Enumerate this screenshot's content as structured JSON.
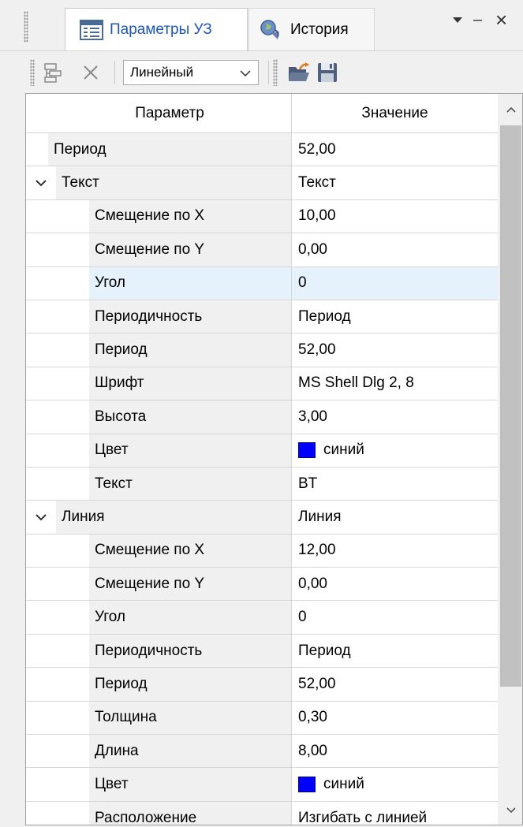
{
  "tabs": [
    {
      "label": "Параметры УЗ",
      "icon": "properties-table-icon",
      "active": true
    },
    {
      "label": "История",
      "icon": "history-icon",
      "active": false
    }
  ],
  "tab_controls": {
    "menu_icon": "dropdown-triangle-icon",
    "minimize": "–",
    "close": "×"
  },
  "toolbar": {
    "mode_value": "Линейный",
    "buttons": [
      "add-node-icon",
      "delete-icon",
      "open-folder-icon",
      "save-icon"
    ]
  },
  "grid": {
    "columns": {
      "param": "Параметр",
      "value": "Значение"
    },
    "rows": [
      {
        "level": 0,
        "name": "Период",
        "value": "52,00"
      },
      {
        "level": 0,
        "name": "Текст",
        "value": "Текст",
        "expanded": true
      },
      {
        "level": 1,
        "name": "Смещение по X",
        "value": "10,00"
      },
      {
        "level": 1,
        "name": "Смещение по Y",
        "value": "0,00"
      },
      {
        "level": 1,
        "name": "Угол",
        "value": "0",
        "selected": true
      },
      {
        "level": 1,
        "name": "Периодичность",
        "value": "Период"
      },
      {
        "level": 1,
        "name": "Период",
        "value": "52,00"
      },
      {
        "level": 1,
        "name": "Шрифт",
        "value": "MS Shell Dlg 2, 8"
      },
      {
        "level": 1,
        "name": "Высота",
        "value": "3,00"
      },
      {
        "level": 1,
        "name": "Цвет",
        "value": "синий",
        "color": "#0000ff"
      },
      {
        "level": 1,
        "name": "Текст",
        "value": "BT"
      },
      {
        "level": 0,
        "name": "Линия",
        "value": "Линия",
        "expanded": true
      },
      {
        "level": 1,
        "name": "Смещение по X",
        "value": "12,00"
      },
      {
        "level": 1,
        "name": "Смещение по Y",
        "value": "0,00"
      },
      {
        "level": 1,
        "name": "Угол",
        "value": "0"
      },
      {
        "level": 1,
        "name": "Периодичность",
        "value": "Период"
      },
      {
        "level": 1,
        "name": "Период",
        "value": "52,00"
      },
      {
        "level": 1,
        "name": "Толщина",
        "value": "0,30"
      },
      {
        "level": 1,
        "name": "Длина",
        "value": "8,00"
      },
      {
        "level": 1,
        "name": "Цвет",
        "value": "синий",
        "color": "#0000ff"
      },
      {
        "level": 1,
        "name": "Расположение",
        "value": "Изгибать с линией"
      }
    ]
  },
  "colors": {
    "accent": "#1b56b8",
    "selection": "#e5f1fb",
    "swatch_blue": "#0000ff"
  }
}
